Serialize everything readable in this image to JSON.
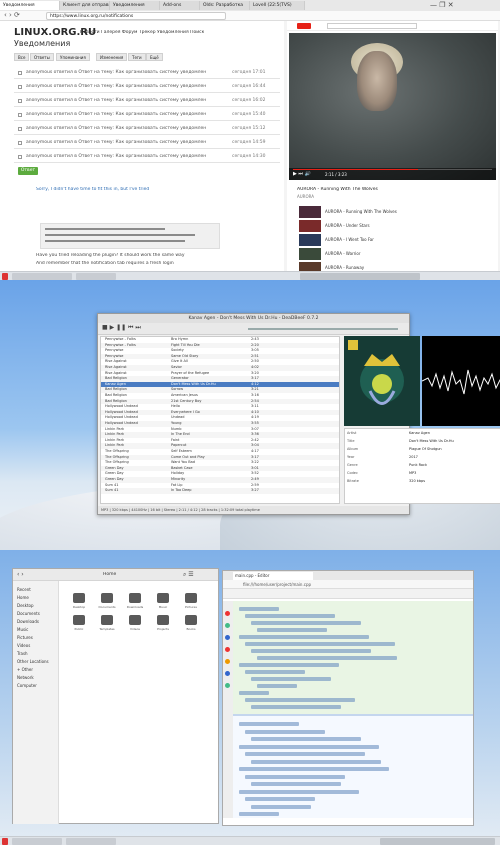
{
  "panel1": {
    "tabs": [
      "Уведомления",
      "Клиент для отправки",
      "Уведомления",
      "Add-ons",
      "Оlds: Разработка",
      "Lovell (22:5(TVS)"
    ],
    "url": "https://www.linux.org.ru/notifications",
    "site_title": "LINUX.ORG.RU",
    "nav": "Новости Галерея Форум Трекер Уведомления Поиск",
    "page_heading": "Уведомления",
    "filters": [
      "Все",
      "Ответы",
      "Упоминания",
      "Изменения",
      "Теги",
      "Ещё"
    ],
    "notifications": [
      {
        "text": "anonymous ответил в Ответ на тему: Как организовать систему уведомлений (Форум)",
        "time": "сегодня 17:01"
      },
      {
        "text": "anonymous ответил в Ответ на тему: Как организовать систему уведомлений (Форум)",
        "time": "сегодня 16:44"
      },
      {
        "text": "anonymous ответил в Ответ на тему: Как организовать систему уведомлений (Форум)",
        "time": "сегодня 16:02"
      },
      {
        "text": "anonymous ответил в Ответ на тему: Как организовать систему уведомлений (Форум)",
        "time": "сегодня 15:40"
      },
      {
        "text": "anonymous ответил в Ответ на тему: Как организовать систему уведомлений (Форум)",
        "time": "сегодня 15:12"
      },
      {
        "text": "anonymous ответил в Ответ на тему: Как организовать систему уведомлений (Форум)",
        "time": "сегодня 14:59"
      },
      {
        "text": "anonymous ответил в Ответ на тему: Как организовать систему уведомлений (Форум)",
        "time": "сегодня 14:30"
      }
    ],
    "submit_label": "Ответ",
    "compose_lines": [
      "Sorry, I didn't have time to fit this in, but I've tried",
      "Have you tried reloading the plugin? It should work the same way",
      "And remember that the notification tab requires a fresh login"
    ],
    "video_title": "AURORA - Running With The Wolves",
    "video_channel": "AURORA",
    "related": [
      "AURORA - Running With The Wolves",
      "AURORA - Under Stars",
      "AURORA - I Went Too Far",
      "AURORA - Warrior",
      "AURORA - Runaway"
    ],
    "video_time": "2:11 / 3:23"
  },
  "panel2": {
    "window_title": "Kanav Agen - Don't Mess With Us Dr.Hu - DeaDBeeF 0.7.2",
    "tracks": [
      {
        "artist": "Pennywise - Folks",
        "title": "Bro Hymn",
        "dur": "2:43"
      },
      {
        "artist": "Pennywise - Folks",
        "title": "Fight Till You Die",
        "dur": "2:20"
      },
      {
        "artist": "Pennywise",
        "title": "Society",
        "dur": "3:05"
      },
      {
        "artist": "Pennywise",
        "title": "Same Old Story",
        "dur": "2:51"
      },
      {
        "artist": "Rise Against",
        "title": "Give It All",
        "dur": "2:50"
      },
      {
        "artist": "Rise Against",
        "title": "Savior",
        "dur": "4:02"
      },
      {
        "artist": "Rise Against",
        "title": "Prayer of the Refugee",
        "dur": "3:20"
      },
      {
        "artist": "Bad Religion",
        "title": "Generator",
        "dur": "3:17"
      },
      {
        "artist": "Kanav Agen",
        "title": "Don't Mess With Us Dr.Hu",
        "dur": "4:12"
      },
      {
        "artist": "Bad Religion",
        "title": "Sorrow",
        "dur": "3:21"
      },
      {
        "artist": "Bad Religion",
        "title": "American Jesus",
        "dur": "3:16"
      },
      {
        "artist": "Bad Religion",
        "title": "21st Century Boy",
        "dur": "2:54"
      },
      {
        "artist": "Hollywood Undead",
        "title": "Hello",
        "dur": "3:11"
      },
      {
        "artist": "Hollywood Undead",
        "title": "Everywhere I Go",
        "dur": "4:10"
      },
      {
        "artist": "Hollywood Undead",
        "title": "Undead",
        "dur": "4:19"
      },
      {
        "artist": "Hollywood Undead",
        "title": "Young",
        "dur": "3:55"
      },
      {
        "artist": "Linkin Park",
        "title": "Numb",
        "dur": "3:07"
      },
      {
        "artist": "Linkin Park",
        "title": "In The End",
        "dur": "3:36"
      },
      {
        "artist": "Linkin Park",
        "title": "Faint",
        "dur": "2:42"
      },
      {
        "artist": "Linkin Park",
        "title": "Papercut",
        "dur": "3:04"
      },
      {
        "artist": "The Offspring",
        "title": "Self Esteem",
        "dur": "4:17"
      },
      {
        "artist": "The Offspring",
        "title": "Come Out and Play",
        "dur": "3:17"
      },
      {
        "artist": "The Offspring",
        "title": "Want You Bad",
        "dur": "3:22"
      },
      {
        "artist": "Green Day",
        "title": "Basket Case",
        "dur": "3:01"
      },
      {
        "artist": "Green Day",
        "title": "Holiday",
        "dur": "3:52"
      },
      {
        "artist": "Green Day",
        "title": "Minority",
        "dur": "2:49"
      },
      {
        "artist": "Sum 41",
        "title": "Fat Lip",
        "dur": "2:59"
      },
      {
        "artist": "Sum 41",
        "title": "In Too Deep",
        "dur": "3:27"
      }
    ],
    "props": [
      {
        "k": "Artist",
        "v": "Kanav Agen"
      },
      {
        "k": "Title",
        "v": "Don't Mess With Us Dr.Hu"
      },
      {
        "k": "Album",
        "v": "Plague Of Shotgun"
      },
      {
        "k": "Year",
        "v": "2017"
      },
      {
        "k": "Genre",
        "v": "Punk Rock"
      },
      {
        "k": "Codec",
        "v": "MP3"
      },
      {
        "k": "Bitrate",
        "v": "320 kbps"
      }
    ],
    "status": "MP3 | 320 kbps | 44100Hz | 16 bit | Stereo | 2:11 / 4:12 | 28 tracks | 1:32:09 total playtime"
  },
  "panel3": {
    "fm_title": "Home",
    "sidebar": [
      "Recent",
      "Home",
      "Desktop",
      "Documents",
      "Downloads",
      "Music",
      "Pictures",
      "Videos",
      "Trash",
      "Other Locations",
      "+ Other",
      "Network",
      "Computer"
    ],
    "folders": [
      "Desktop",
      "Documents",
      "Downloads",
      "Music",
      "Pictures",
      "Public",
      "Templates",
      "Videos",
      "Projects",
      "Books"
    ],
    "editor_tab": "main.cpp - Editor",
    "editor_url": "file:///home/user/project/main.cpp"
  }
}
